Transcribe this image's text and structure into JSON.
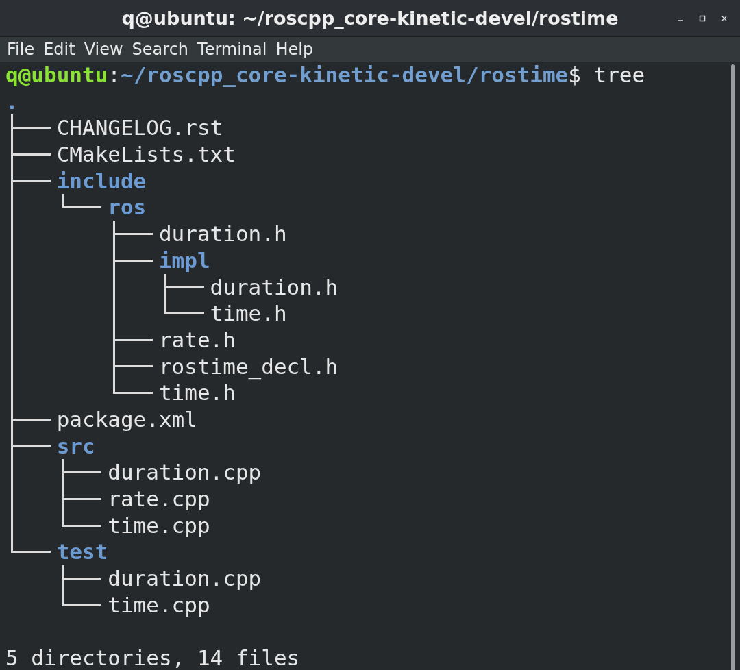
{
  "window": {
    "title": "q@ubuntu: ~/roscpp_core-kinetic-devel/rostime"
  },
  "menu": [
    "File",
    "Edit",
    "View",
    "Search",
    "Terminal",
    "Help"
  ],
  "prompt": {
    "user_host": "q@ubuntu",
    "separator": ":",
    "path": "~/roscpp_core-kinetic-devel/rostime",
    "symbol": "$",
    "command": "tree"
  },
  "tree": {
    "name": ".",
    "kind": "dir",
    "children": [
      {
        "name": "CHANGELOG.rst",
        "kind": "file"
      },
      {
        "name": "CMakeLists.txt",
        "kind": "file"
      },
      {
        "name": "include",
        "kind": "dir",
        "children": [
          {
            "name": "ros",
            "kind": "dir",
            "children": [
              {
                "name": "duration.h",
                "kind": "file"
              },
              {
                "name": "impl",
                "kind": "dir",
                "children": [
                  {
                    "name": "duration.h",
                    "kind": "file"
                  },
                  {
                    "name": "time.h",
                    "kind": "file"
                  }
                ]
              },
              {
                "name": "rate.h",
                "kind": "file"
              },
              {
                "name": "rostime_decl.h",
                "kind": "file"
              },
              {
                "name": "time.h",
                "kind": "file"
              }
            ]
          }
        ]
      },
      {
        "name": "package.xml",
        "kind": "file"
      },
      {
        "name": "src",
        "kind": "dir",
        "children": [
          {
            "name": "duration.cpp",
            "kind": "file"
          },
          {
            "name": "rate.cpp",
            "kind": "file"
          },
          {
            "name": "time.cpp",
            "kind": "file"
          }
        ]
      },
      {
        "name": "test",
        "kind": "dir",
        "children": [
          {
            "name": "duration.cpp",
            "kind": "file"
          },
          {
            "name": "time.cpp",
            "kind": "file"
          }
        ]
      }
    ]
  },
  "summary": "5 directories, 14 files"
}
